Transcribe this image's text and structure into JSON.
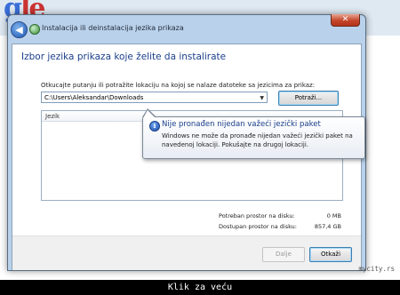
{
  "background": {
    "logo_letters": [
      "g",
      "le"
    ]
  },
  "window": {
    "title": "Instalacija ili deinstalacija jezika prikaza",
    "close_glyph": "✕",
    "back_glyph": "◀"
  },
  "main": {
    "heading": "Izbor jezika prikaza koje želite da instalirate",
    "instruction": "Otkucajte putanju ili potražite lokaciju na kojoj se nalaze datoteke sa jezicima za prikaz:",
    "path_value": "C:\\Users\\Aleksandar\\Downloads",
    "browse_label": "Potraži...",
    "list_header": "Jezik"
  },
  "tooltip": {
    "title": "Nije pronađen nijedan važeći jezički paket",
    "body": "Windows ne može da pronađe nijedan važeći jezički paket na navedenoj lokaciji. Pokušajte na drugoj lokaciji.",
    "icon_glyph": "i"
  },
  "disk": {
    "required_label": "Potreban prostor na disku:",
    "required_value": "0 MB",
    "available_label": "Dostupan prostor na disku:",
    "available_value": "857,4 GB"
  },
  "footer": {
    "next_label": "Dalje",
    "cancel_label": "Otkaži"
  },
  "watermark": "mycity.rs",
  "caption": "Klik za veću",
  "colors": {
    "heading": "#1a3e8a",
    "window_frame": "#b9d1ea",
    "close_button": "#c4462b"
  }
}
